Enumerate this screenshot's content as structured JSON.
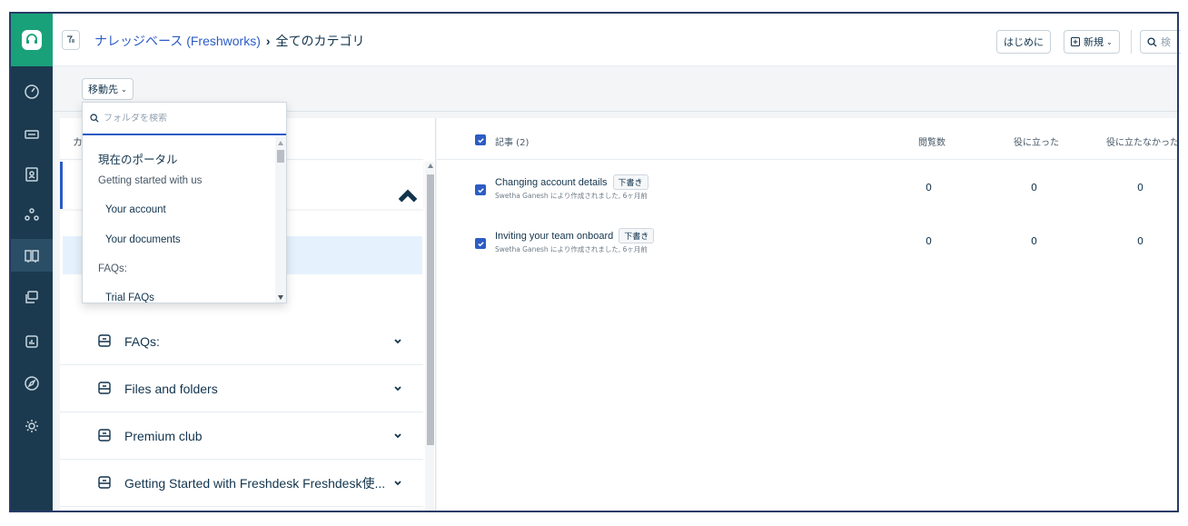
{
  "app": {
    "brand_color": "#19a17a",
    "nav_bg": "#1b3a4f",
    "link_color": "#2c5cc5"
  },
  "nav": {
    "items": [
      {
        "name": "dashboard-icon"
      },
      {
        "name": "tickets-icon"
      },
      {
        "name": "contacts-icon"
      },
      {
        "name": "groups-icon"
      },
      {
        "name": "knowledge-base-icon",
        "active": true
      },
      {
        "name": "social-icon"
      },
      {
        "name": "reports-icon"
      },
      {
        "name": "explore-icon"
      },
      {
        "name": "settings-icon"
      }
    ]
  },
  "header": {
    "breadcrumb_link": "ナレッジベース (Freshworks)",
    "breadcrumb_sep": "›",
    "breadcrumb_current": "全てのカテゴリ",
    "getting_started": "はじめに",
    "new_label": "新規",
    "search_placeholder": "検"
  },
  "toolbar": {
    "move_to": "移動先"
  },
  "left_panel": {
    "header": "カテゴリ",
    "categories": [
      {
        "label": "FAQs:"
      },
      {
        "label": "Files and folders"
      },
      {
        "label": "Premium club"
      },
      {
        "label": "Getting Started with Freshdesk   Freshdesk使..."
      }
    ]
  },
  "dropdown": {
    "search_placeholder": "フォルダを検索",
    "items": [
      {
        "label": "現在のポータル"
      },
      {
        "label": "Getting started with us"
      },
      {
        "label": "Your account"
      },
      {
        "label": "Your documents"
      },
      {
        "label": "FAQs:"
      },
      {
        "label": "Trial FAQs"
      }
    ]
  },
  "articles": {
    "header_label": "記事 (2)",
    "col_views": "閲覧数",
    "col_helpful": "役に立った",
    "col_not_helpful": "役に立たなかった",
    "rows": [
      {
        "title": "Changing account details",
        "badge": "下書き",
        "meta": "Swetha Ganesh により作成されました, 6ヶ月前",
        "views": "0",
        "helpful": "0",
        "not_helpful": "0"
      },
      {
        "title": "Inviting your team onboard",
        "badge": "下書き",
        "meta": "Swetha Ganesh により作成されました, 6ヶ月前",
        "views": "0",
        "helpful": "0",
        "not_helpful": "0"
      }
    ]
  }
}
